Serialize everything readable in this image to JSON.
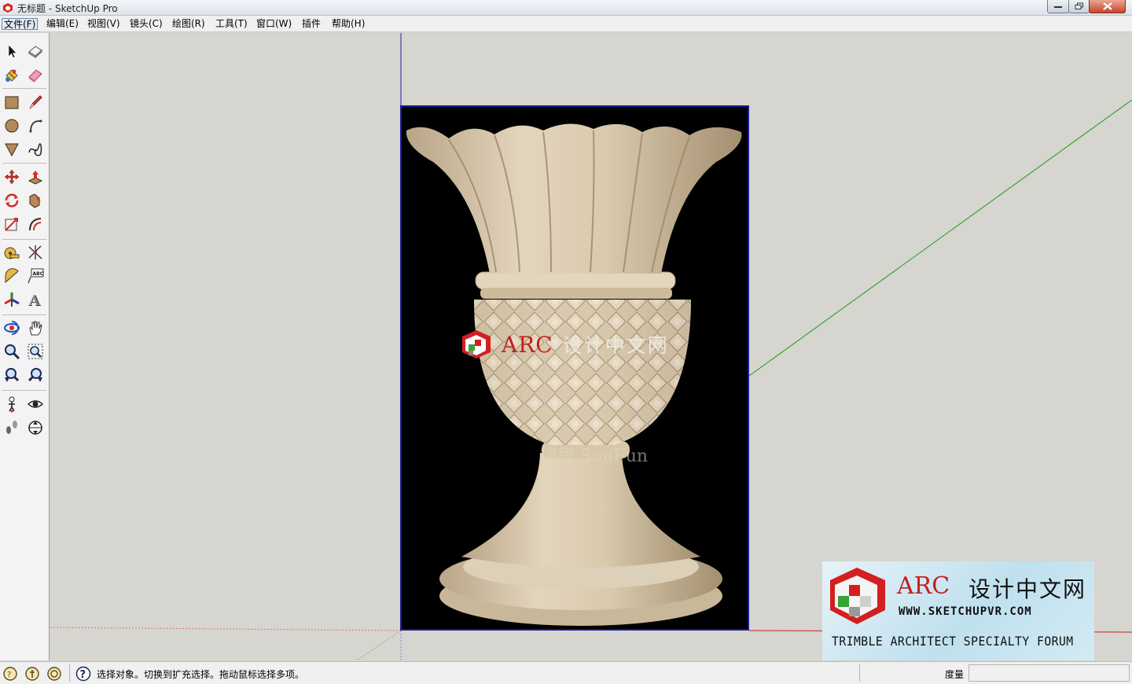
{
  "window": {
    "title": "无标题 - SketchUp Pro"
  },
  "menubar": {
    "items": [
      "文件(F)",
      "编辑(E)",
      "视图(V)",
      "镜头(C)",
      "绘图(R)",
      "工具(T)",
      "窗口(W)",
      "插件",
      "帮助(H)"
    ]
  },
  "toolbar": {
    "tools": [
      "select-tool",
      "make-component-tool",
      "paint-bucket-tool",
      "eraser-tool",
      "rectangle-tool",
      "line-tool",
      "circle-tool",
      "arc-tool",
      "polygon-tool",
      "freehand-tool",
      "move-tool",
      "push-pull-tool",
      "rotate-tool",
      "follow-me-tool",
      "scale-tool",
      "offset-tool",
      "tape-measure-tool",
      "dimension-tool",
      "protractor-tool",
      "text-tool",
      "axes-tool",
      "3d-text-tool",
      "orbit-tool",
      "pan-tool",
      "zoom-tool",
      "zoom-window-tool",
      "previous-view-tool",
      "next-view-tool",
      "position-camera-tool",
      "look-around-tool",
      "walk-tool",
      "section-plane-tool"
    ]
  },
  "canvas": {
    "watermark_middle": {
      "arc": "ARC",
      "chinese": "设计中文网"
    },
    "image_watermark": "搜房 SouFun",
    "banner": {
      "arc": "ARC",
      "chinese": "设计中文网",
      "url": "WWW.SKETCHUPVR.COM",
      "forum": "TRIMBLE  ARCHITECT SPECIALTY FORUM"
    },
    "axis_colors": {
      "red": "#cc1f1f",
      "green": "#1a9a1a",
      "blue": "#2222aa"
    }
  },
  "statusbar": {
    "message": "选择对象。切换到扩充选择。拖动鼠标选择多项。",
    "measure_label": "度量",
    "measure_value": ""
  }
}
